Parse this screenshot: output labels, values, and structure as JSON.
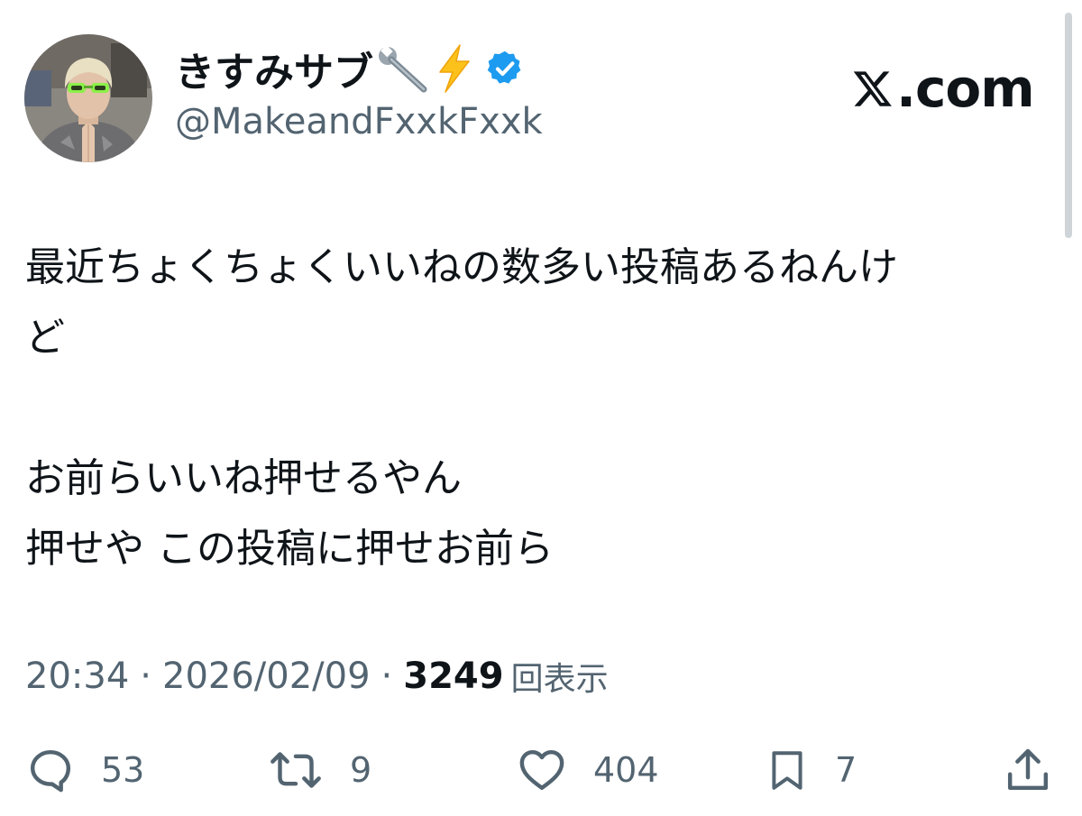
{
  "tweet": {
    "author": {
      "display_name": "きすみサブ",
      "name_emojis": [
        "wrench-emoji",
        "lightning-emoji"
      ],
      "verified": true,
      "handle": "@MakeandFxxkFxxk"
    },
    "brand": {
      "logo_text": ".com",
      "logo_icon": "x-logo-icon"
    },
    "text_lines": [
      "最近ちょくちょくいいねの数多い投稿あるねんけ",
      "ど",
      "",
      "お前らいいね押せるやん",
      "押せや この投稿に押せお前ら"
    ],
    "meta": {
      "time": "20:34",
      "separator": "·",
      "date": "2026/02/09",
      "views_count": "3249",
      "views_label": "回表示"
    },
    "actions": {
      "reply": {
        "icon": "reply-icon",
        "count": "53"
      },
      "repost": {
        "icon": "repost-icon",
        "count": "9"
      },
      "like": {
        "icon": "heart-icon",
        "count": "404"
      },
      "bookmark": {
        "icon": "bookmark-icon",
        "count": "7"
      },
      "share": {
        "icon": "share-icon"
      }
    },
    "colors": {
      "text_primary": "#0f1419",
      "text_secondary": "#536471",
      "verified_blue": "#1d9bf0",
      "background": "#ffffff"
    }
  }
}
